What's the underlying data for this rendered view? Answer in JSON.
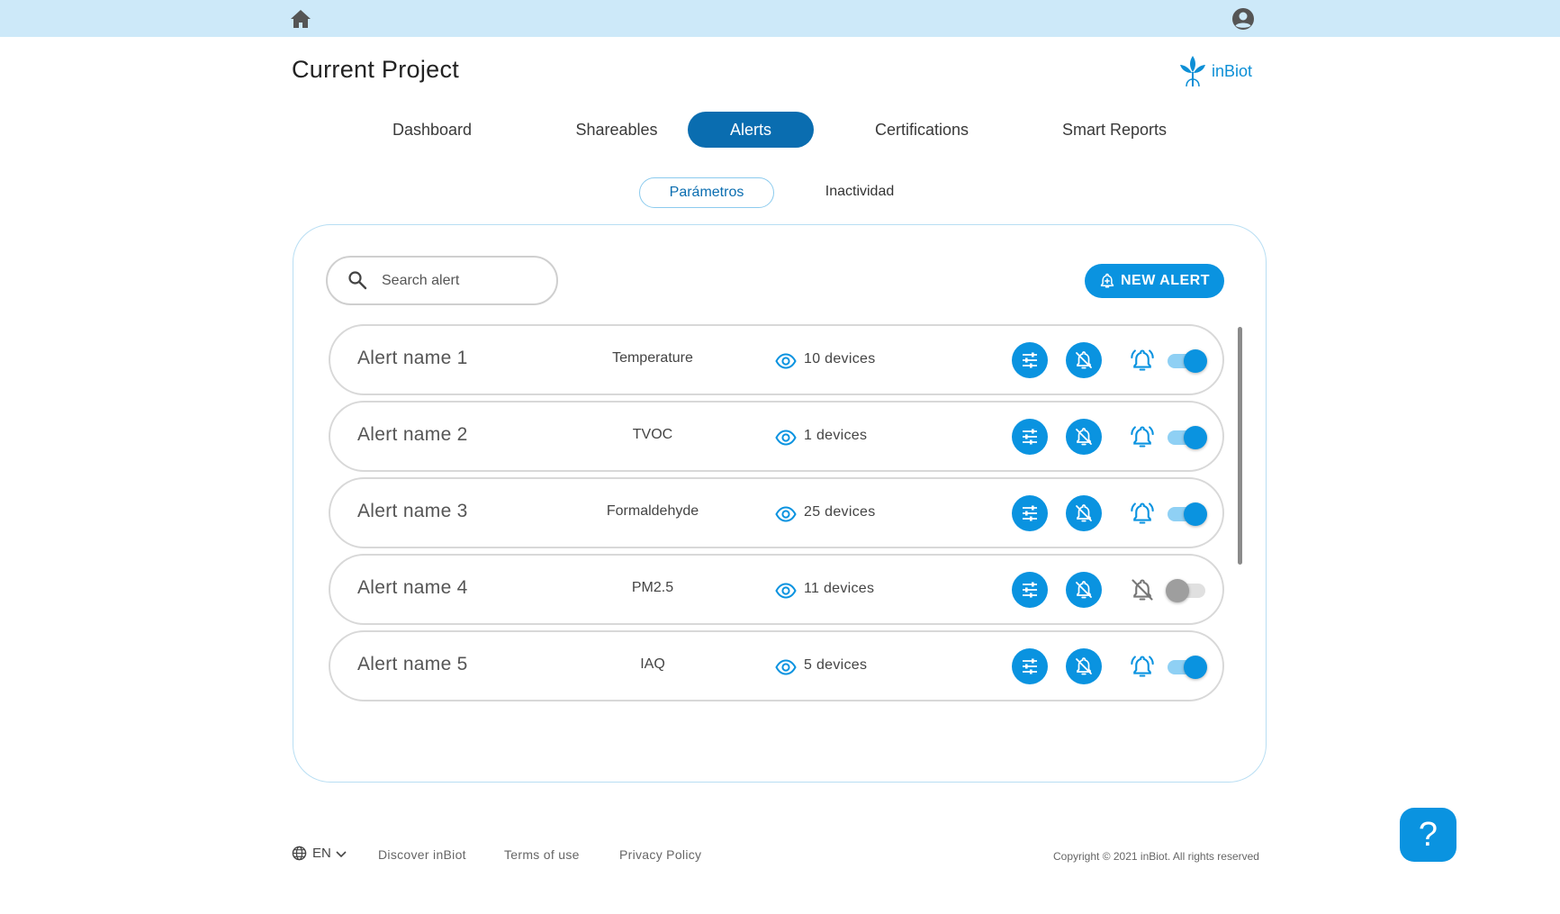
{
  "topbar": {
    "home_icon": "home-icon",
    "account_icon": "account-circle-icon"
  },
  "project": {
    "title": "Current Project"
  },
  "brand": {
    "name": "inBiot",
    "color": "#0d8fd6"
  },
  "tabs": [
    {
      "label": "Dashboard",
      "active": false
    },
    {
      "label": "Shareables",
      "active": false
    },
    {
      "label": "Alerts",
      "active": true
    },
    {
      "label": "Certifications",
      "active": false
    },
    {
      "label": "Smart Reports",
      "active": false
    }
  ],
  "subtabs": [
    {
      "label": "Parámetros",
      "active": true
    },
    {
      "label": "Inactividad",
      "active": false
    }
  ],
  "search": {
    "placeholder": "Search alert",
    "value": ""
  },
  "new_alert": {
    "label": "NEW ALERT"
  },
  "alerts": [
    {
      "name": "Alert name 1",
      "parameter": "Temperature",
      "devices": "10 devices",
      "enabled": true
    },
    {
      "name": "Alert name 2",
      "parameter": "TVOC",
      "devices": "1 devices",
      "enabled": true
    },
    {
      "name": "Alert name 3",
      "parameter": "Formaldehyde",
      "devices": "25 devices",
      "enabled": true
    },
    {
      "name": "Alert name 4",
      "parameter": "PM2.5",
      "devices": "11 devices",
      "enabled": false
    },
    {
      "name": "Alert name 5",
      "parameter": "IAQ",
      "devices": "5 devices",
      "enabled": true
    }
  ],
  "footer": {
    "language": "EN",
    "links": [
      "Discover inBiot",
      "Terms of use",
      "Privacy Policy"
    ],
    "copyright": "Copyright © 2021 inBiot. All rights reserved"
  },
  "help": {
    "label": "?"
  },
  "colors": {
    "accent": "#0a93e0",
    "active_tab": "#0a6db0",
    "topbar": "#cde9f9",
    "panel_border": "#b8def3"
  }
}
